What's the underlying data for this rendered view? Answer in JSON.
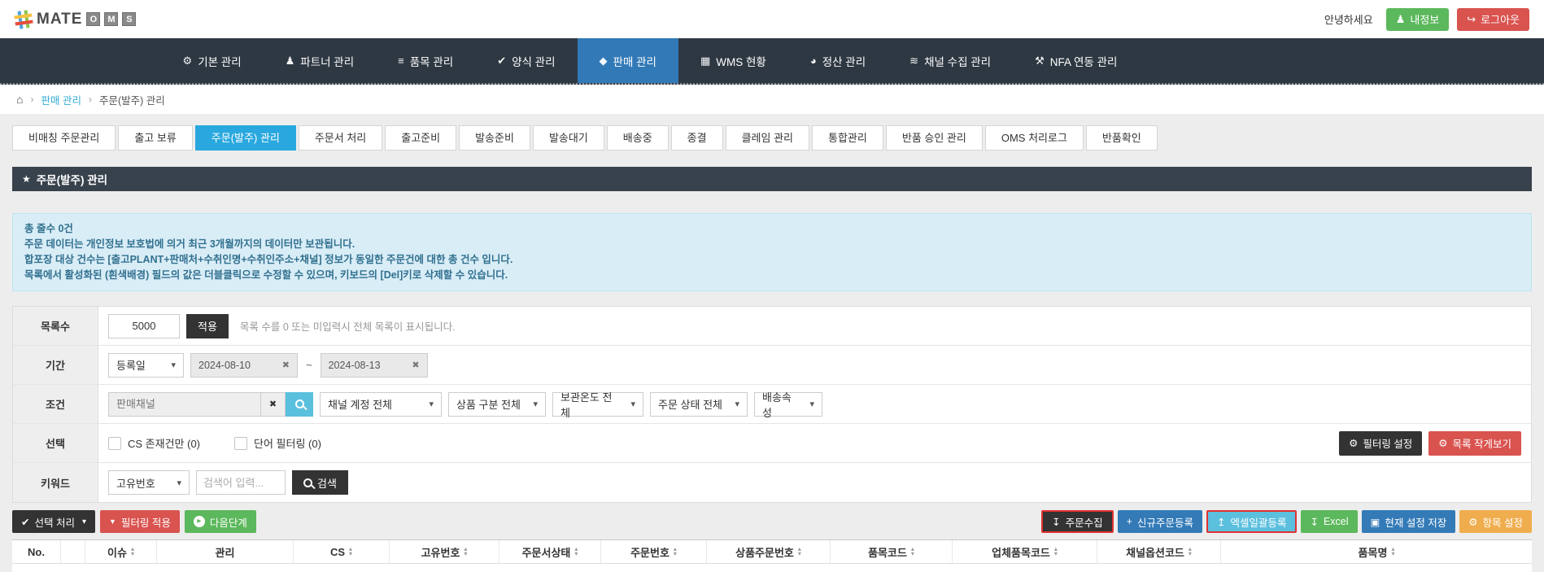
{
  "colors": {
    "nav_bg": "#2e3842",
    "nav_active": "#3279b7",
    "tab_active": "#29a8df",
    "title_bg": "#38424c",
    "info_bg": "#d9edf7",
    "info_text": "#31708f",
    "primary": "#337ab7",
    "success": "#5cb85c",
    "danger": "#d9534f",
    "light_blue": "#5bc0de",
    "warning": "#f0ad4e",
    "dark": "#333333",
    "highlight_outline": "#e03131"
  },
  "icons": {
    "gear": "⚙",
    "person": "♟",
    "list": "≡",
    "check": "✔",
    "gem": "◆",
    "screen": "▦",
    "pie": "◕",
    "rss": "≋",
    "wrench": "⚒",
    "home": "⌂",
    "star": "★",
    "close": "✖",
    "caret": "▾",
    "download": "↧",
    "upload": "↥",
    "plus": "+",
    "save": "▣",
    "logout": "↪",
    "sort_up": "▴",
    "sort_down": "▾",
    "next": "▸",
    "sep": "›",
    "filter": "▼",
    "tilde": "~"
  },
  "header": {
    "logo_mate": "MATE",
    "logo_o": "O",
    "logo_m": "M",
    "logo_s": "S",
    "greeting": "안녕하세요",
    "my_info_label": "내정보",
    "logout_label": "로그아웃"
  },
  "nav_items": [
    {
      "label": "기본 관리"
    },
    {
      "label": "파트너 관리"
    },
    {
      "label": "품목 관리"
    },
    {
      "label": "양식 관리"
    },
    {
      "label": "판매 관리"
    },
    {
      "label": "WMS 현황"
    },
    {
      "label": "정산 관리"
    },
    {
      "label": "채널 수집 관리"
    },
    {
      "label": "NFA 연동 관리"
    }
  ],
  "breadcrumb": {
    "section": "판매 관리",
    "current": "주문(발주) 관리"
  },
  "tabs": [
    {
      "label": "비매칭 주문관리"
    },
    {
      "label": "출고 보류"
    },
    {
      "label": "주문(발주) 관리"
    },
    {
      "label": "주문서 처리"
    },
    {
      "label": "출고준비"
    },
    {
      "label": "발송준비"
    },
    {
      "label": "발송대기"
    },
    {
      "label": "배송중"
    },
    {
      "label": "종결"
    },
    {
      "label": "클레임 관리"
    },
    {
      "label": "통합관리"
    },
    {
      "label": "반품 승인 관리"
    },
    {
      "label": "OMS 처리로그"
    },
    {
      "label": "반품확인"
    }
  ],
  "page_title": "주문(발주) 관리",
  "info": {
    "line1": "총 줄수 0건",
    "line2": "주문 데이터는 개인정보 보호법에 의거 최근 3개월까지의 데이터만 보관됩니다.",
    "line3": "합포장 대상 건수는 [출고PLANT+판매처+수취인명+수취인주소+채널] 정보가 동일한 주문건에 대한 총 건수 입니다.",
    "line4": "목록에서 활성화된 (흰색배경) 필드의 값은 더블클릭으로 수정할 수 있으며, 키보드의 [Del]키로 삭제할 수 있습니다."
  },
  "filters": {
    "list_count": {
      "label": "목록수",
      "value": "5000",
      "apply_label": "적용",
      "hint": "목록 수를 0 또는 미입력시 전체 목록이 표시됩니다."
    },
    "period": {
      "label": "기간",
      "type_select": "등록일",
      "date_from": "2024-08-10",
      "date_to": "2024-08-13"
    },
    "condition": {
      "label": "조건",
      "channel_placeholder": "판매채널",
      "select_channel_account": "채널 계정 전체",
      "select_product_type": "상품 구분 전체",
      "select_storage_temp": "보관온도 전체",
      "select_order_status": "주문 상태 전체",
      "select_delivery_attr": "배송속성"
    },
    "select_row": {
      "label": "선택",
      "checkbox_cs": "CS 존재건만 (0)",
      "checkbox_word": "단어 필터링 (0)",
      "btn_filter_settings": "필터링 설정",
      "btn_compact_view": "목록 작게보기"
    },
    "keyword": {
      "label": "키워드",
      "type_select": "고유번호",
      "placeholder": "검색어 입력...",
      "search_label": "검색"
    }
  },
  "actions": {
    "select_process": "선택 처리",
    "apply_filter": "필터링 적용",
    "next_step": "다음단계",
    "collect_orders": "주문수집",
    "new_order": "신규주문등록",
    "excel_bulk": "엑셀일괄등록",
    "excel": "Excel",
    "save_settings": "현재 설정 저장",
    "item_settings": "항목 설정"
  },
  "table": {
    "columns": [
      {
        "label": "No.",
        "sortable": false
      },
      {
        "label": "",
        "sortable": false
      },
      {
        "label": "이슈",
        "sortable": true
      },
      {
        "label": "관리",
        "sortable": false
      },
      {
        "label": "CS",
        "sortable": true
      },
      {
        "label": "고유번호",
        "sortable": true
      },
      {
        "label": "주문서상태",
        "sortable": true
      },
      {
        "label": "주문번호",
        "sortable": true
      },
      {
        "label": "상품주문번호",
        "sortable": true
      },
      {
        "label": "품목코드",
        "sortable": true
      },
      {
        "label": "업체품목코드",
        "sortable": true
      },
      {
        "label": "채널옵션코드",
        "sortable": true
      },
      {
        "label": "품목명",
        "sortable": true
      }
    ]
  }
}
